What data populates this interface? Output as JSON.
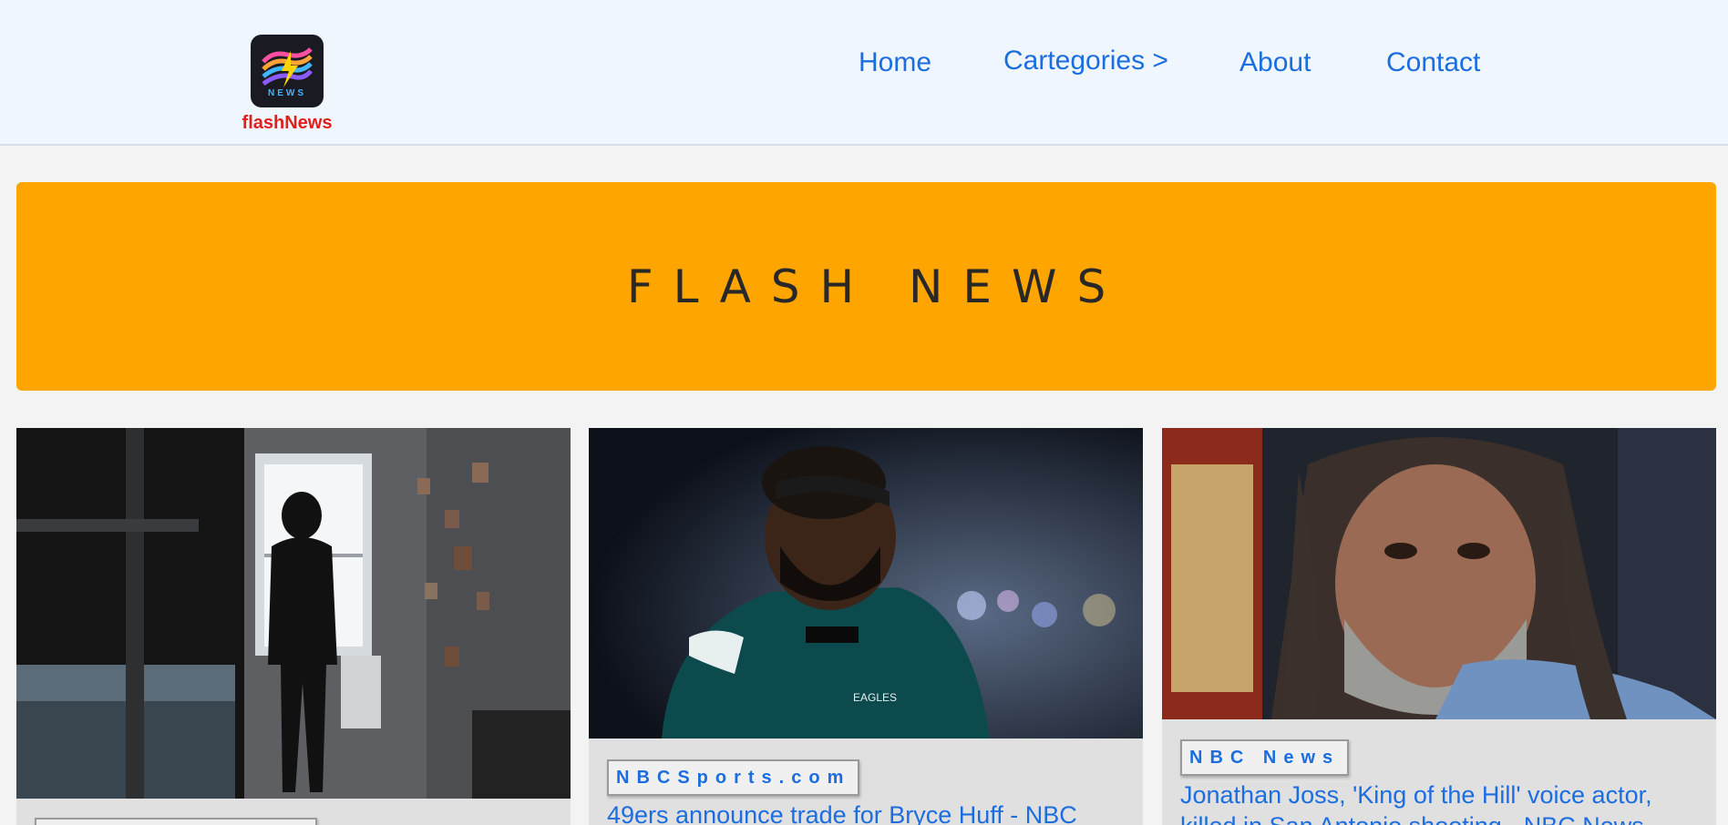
{
  "header": {
    "logo_badge": "NEWS",
    "brand": "flashNews",
    "nav": [
      {
        "label": "Home"
      },
      {
        "label": "Cartegories >"
      },
      {
        "label": "About"
      },
      {
        "label": "Contact"
      }
    ]
  },
  "banner": {
    "title": "FLASH NEWS"
  },
  "colors": {
    "accent": "#1b6de0",
    "brand": "#e0201c",
    "banner": "#fea500"
  },
  "cards": [
    {
      "image": "woman-in-bedroom-silhouette-photo",
      "source": "",
      "headline": ""
    },
    {
      "image": "eagles-football-player-photo",
      "source": "NBCSports.com",
      "headline": "49ers announce trade for Bryce Huff - NBC"
    },
    {
      "image": "man-long-grey-hair-portrait-photo",
      "source": "NBC News",
      "headline": "Jonathan Joss, 'King of the Hill' voice actor, killed in San Antonio shooting - NBC News"
    }
  ]
}
